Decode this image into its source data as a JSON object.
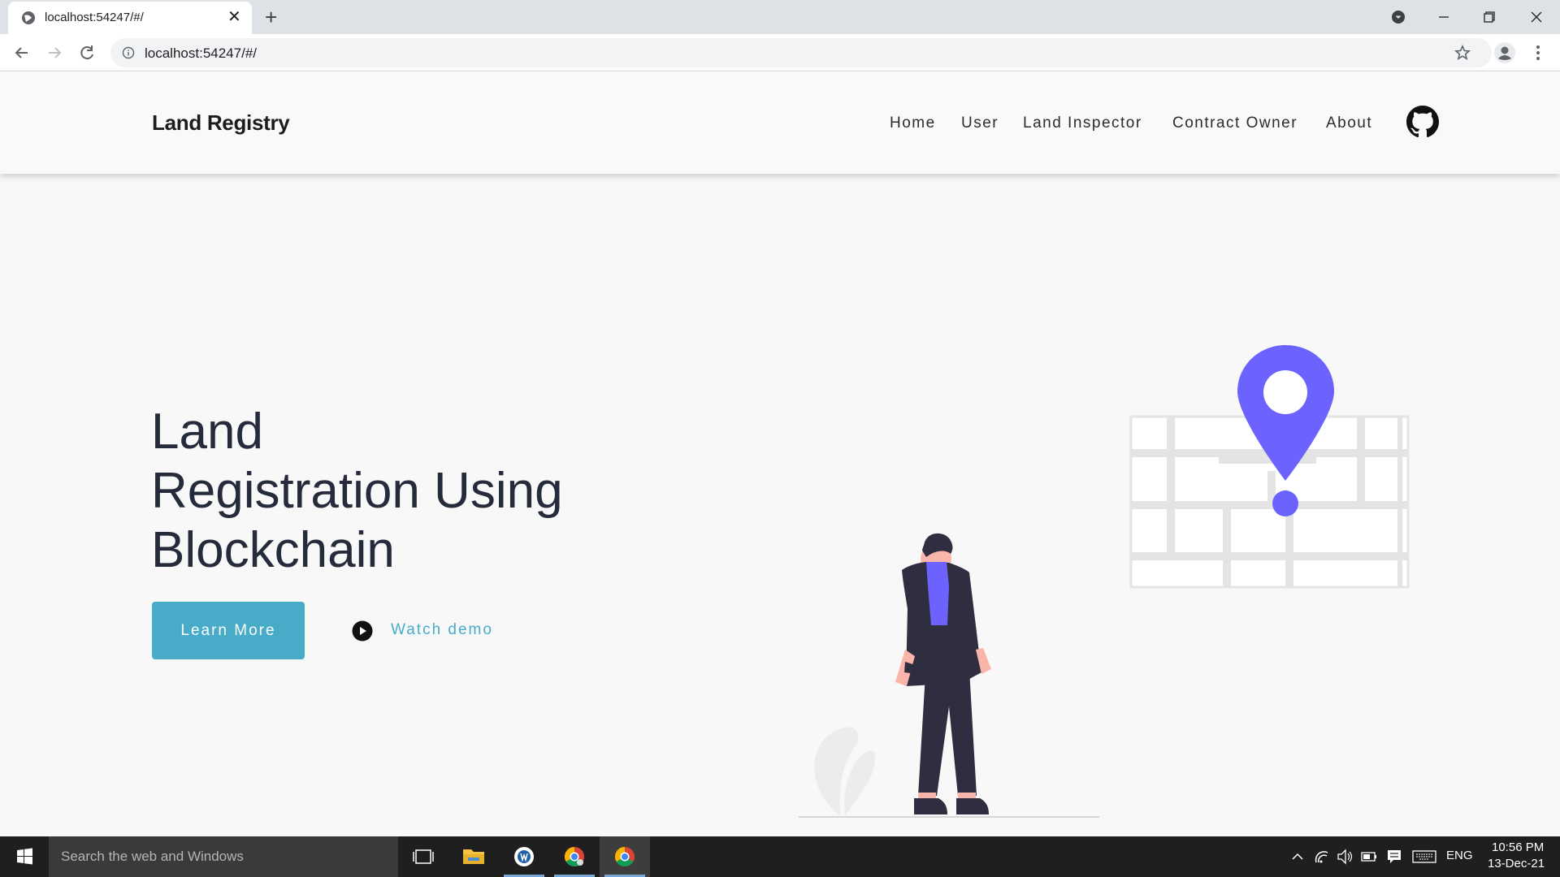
{
  "browser": {
    "tab_title": "localhost:54247/#/",
    "tab_close": "✕",
    "new_tab": "+",
    "url": "localhost:54247/#/"
  },
  "site": {
    "brand": "Land Registry",
    "nav": [
      "Home",
      "User",
      "Land Inspector",
      "Contract Owner",
      "About"
    ]
  },
  "hero": {
    "title_line1": "Land",
    "title_line2": "Registration Using",
    "title_line3": "Blockchain",
    "learn_more": "Learn More",
    "watch_demo": "Watch demo"
  },
  "colors": {
    "accent": "#48acc9",
    "pin": "#6c63ff",
    "text_dark": "#252b3b"
  },
  "taskbar": {
    "search_placeholder": "Search the web and Windows",
    "language": "ENG",
    "time": "10:56 PM",
    "date": "13-Dec-21",
    "apps": [
      "task-view-icon",
      "file-explorer-icon",
      "app-icon",
      "chrome-icon",
      "chrome-icon"
    ]
  }
}
